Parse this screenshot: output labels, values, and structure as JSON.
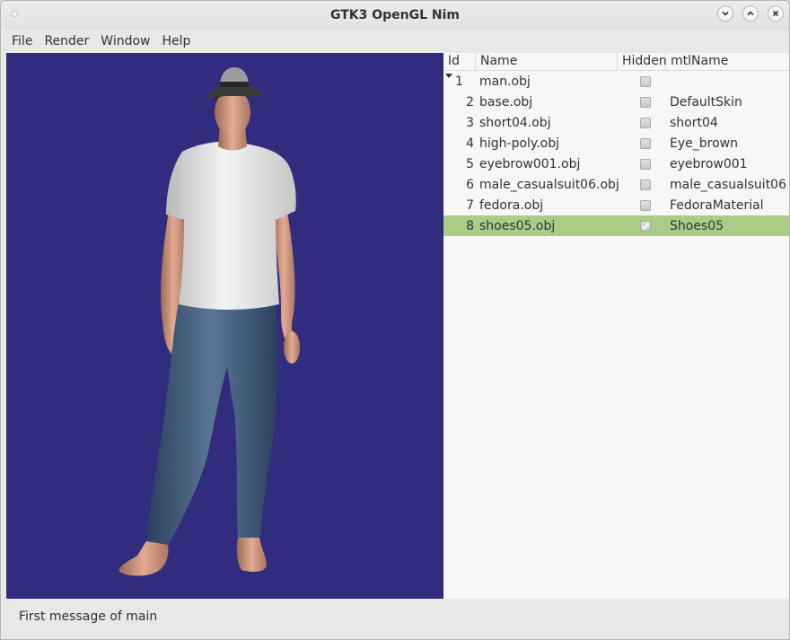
{
  "window": {
    "title": "GTK3 OpenGL Nim"
  },
  "menu": [
    "File",
    "Render",
    "Window",
    "Help"
  ],
  "icons": {
    "minimize": "chevron-down-icon",
    "maximize": "chevron-up-icon",
    "close": "close-icon"
  },
  "viewport": {
    "background": "#322c7f"
  },
  "tree": {
    "columns": [
      "Id",
      "Name",
      "Hidden",
      "mtlName"
    ],
    "rows": [
      {
        "id": "1",
        "name": "man.obj",
        "hidden": false,
        "mtl": ""
      },
      {
        "id": "2",
        "name": "base.obj",
        "hidden": false,
        "mtl": "DefaultSkin"
      },
      {
        "id": "3",
        "name": "short04.obj",
        "hidden": false,
        "mtl": "short04"
      },
      {
        "id": "4",
        "name": "high-poly.obj",
        "hidden": false,
        "mtl": "Eye_brown"
      },
      {
        "id": "5",
        "name": "eyebrow001.obj",
        "hidden": false,
        "mtl": "eyebrow001"
      },
      {
        "id": "6",
        "name": "male_casualsuit06.obj",
        "hidden": false,
        "mtl": "male_casualsuit06"
      },
      {
        "id": "7",
        "name": "fedora.obj",
        "hidden": false,
        "mtl": "FedoraMaterial"
      },
      {
        "id": "8",
        "name": "shoes05.obj",
        "hidden": true,
        "mtl": "Shoes05",
        "selected": true
      }
    ],
    "selected_color": "#a9cd86"
  },
  "status": {
    "message": "First message of main"
  }
}
